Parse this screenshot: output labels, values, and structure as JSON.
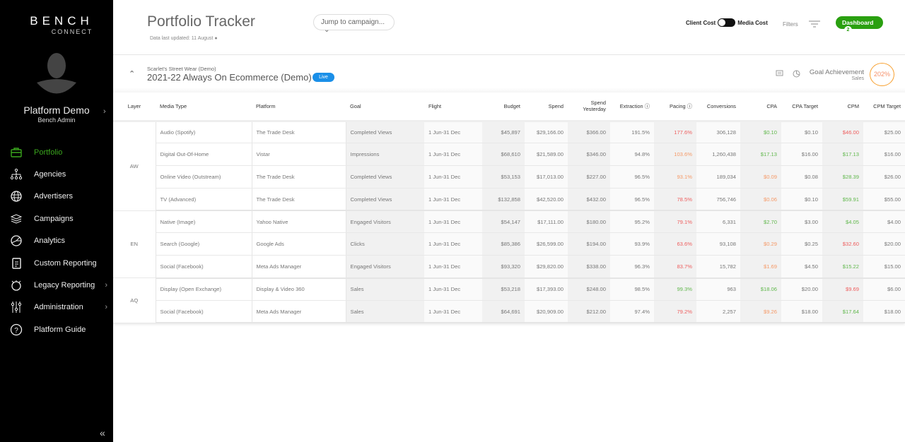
{
  "sidebar": {
    "logo_main": "BENCH",
    "logo_sub": "CONNECT",
    "user_name": "Platform Demo",
    "user_role": "Bench Admin",
    "items": [
      {
        "label": "Portfolio",
        "icon": "briefcase-icon",
        "active": true
      },
      {
        "label": "Agencies",
        "icon": "hierarchy-icon"
      },
      {
        "label": "Advertisers",
        "icon": "globe-icon"
      },
      {
        "label": "Campaigns",
        "icon": "layers-icon"
      },
      {
        "label": "Analytics",
        "icon": "pie-chart-icon"
      },
      {
        "label": "Custom Reporting",
        "icon": "document-icon"
      },
      {
        "label": "Legacy Reporting",
        "icon": "stopwatch-icon",
        "chevron": true
      },
      {
        "label": "Administration",
        "icon": "sliders-icon",
        "chevron": true
      },
      {
        "label": "Platform Guide",
        "icon": "help-icon"
      }
    ]
  },
  "header": {
    "title": "Portfolio Tracker",
    "updated": "Data last updated: 11 August",
    "jump_placeholder": "Jump to campaign...",
    "client_cost": "Client Cost",
    "media_cost": "Media Cost",
    "filters": "Filters",
    "dashboard": "Dashboard",
    "dashboard_count": "2"
  },
  "campaign": {
    "client": "Scarlet's Street Wear (Demo)",
    "name": "2021-22 Always On Ecommerce (Demo)",
    "status": "Live",
    "goal_label": "Goal Achievement",
    "goal_type": "Sales",
    "goal_value": "202%"
  },
  "colors": {
    "green": "#62b84e",
    "orange": "#f59a68",
    "red": "#ee5f5f"
  },
  "table": {
    "headers": [
      "Layer",
      "Media Type",
      "Platform",
      "Goal",
      "Flight",
      "Budget",
      "Spend",
      "Spend Yesterday",
      "Extraction ⓘ",
      "Pacing ⓘ",
      "Conversions",
      "CPA",
      "CPA Target",
      "CPM",
      "CPM Target"
    ],
    "groups": [
      {
        "layer": "AW",
        "rows": [
          [
            "Audio (Spotify)",
            "The Trade Desk",
            "Completed Views",
            "1 Jun-31 Dec",
            "$45,897",
            "$29,166.00",
            "$366.00",
            "191.5%",
            [
              "177.6%",
              "red"
            ],
            "306,128",
            [
              "$0.10",
              "green"
            ],
            "$0.10",
            [
              "$46.00",
              "red"
            ],
            "$25.00"
          ],
          [
            "Digital Out-Of-Home",
            "Vistar",
            "Impressions",
            "1 Jun-31 Dec",
            "$68,610",
            "$21,589.00",
            "$346.00",
            "94.8%",
            [
              "103.6%",
              "orange"
            ],
            "1,260,438",
            [
              "$17.13",
              "green"
            ],
            "$16.00",
            [
              "$17.13",
              "green"
            ],
            "$16.00"
          ],
          [
            "Online Video (Outstream)",
            "The Trade Desk",
            "Completed Views",
            "1 Jun-31 Dec",
            "$53,153",
            "$17,013.00",
            "$227.00",
            "96.5%",
            [
              "93.1%",
              "orange"
            ],
            "189,034",
            [
              "$0.09",
              "orange"
            ],
            "$0.08",
            [
              "$28.39",
              "green"
            ],
            "$26.00"
          ],
          [
            "TV (Advanced)",
            "The Trade Desk",
            "Completed Views",
            "1 Jun-31 Dec",
            "$132,858",
            "$42,520.00",
            "$432.00",
            "96.5%",
            [
              "78.5%",
              "red"
            ],
            "756,746",
            [
              "$0.06",
              "orange"
            ],
            "$0.10",
            [
              "$59.91",
              "green"
            ],
            "$55.00"
          ]
        ]
      },
      {
        "layer": "EN",
        "rows": [
          [
            "Native (Image)",
            "Yahoo Native",
            "Engaged Visitors",
            "1 Jun-31 Dec",
            "$54,147",
            "$17,111.00",
            "$180.00",
            "95.2%",
            [
              "79.1%",
              "red"
            ],
            "6,331",
            [
              "$2.70",
              "green"
            ],
            "$3.00",
            [
              "$4.05",
              "green"
            ],
            "$4.00"
          ],
          [
            "Search (Google)",
            "Google Ads",
            "Clicks",
            "1 Jun-31 Dec",
            "$85,386",
            "$26,599.00",
            "$194.00",
            "93.9%",
            [
              "63.6%",
              "red"
            ],
            "93,108",
            [
              "$0.29",
              "orange"
            ],
            "$0.25",
            [
              "$32.60",
              "red"
            ],
            "$20.00"
          ],
          [
            "Social (Facebook)",
            "Meta Ads Manager",
            "Engaged Visitors",
            "1 Jun-31 Dec",
            "$93,320",
            "$29,820.00",
            "$338.00",
            "96.3%",
            [
              "83.7%",
              "red"
            ],
            "15,782",
            [
              "$1.69",
              "orange"
            ],
            "$4.50",
            [
              "$15.22",
              "green"
            ],
            "$15.00"
          ]
        ]
      },
      {
        "layer": "AQ",
        "rows": [
          [
            "Display (Open Exchange)",
            "Display & Video 360",
            "Sales",
            "1 Jun-31 Dec",
            "$53,218",
            "$17,393.00",
            "$248.00",
            "98.5%",
            [
              "99.3%",
              "green"
            ],
            "963",
            [
              "$18.06",
              "green"
            ],
            "$20.00",
            [
              "$9.69",
              "red"
            ],
            "$6.00"
          ],
          [
            "Social (Facebook)",
            "Meta Ads Manager",
            "Sales",
            "1 Jun-31 Dec",
            "$64,691",
            "$20,909.00",
            "$212.00",
            "97.4%",
            [
              "79.2%",
              "red"
            ],
            "2,257",
            [
              "$9.26",
              "orange"
            ],
            "$18.00",
            [
              "$17.64",
              "green"
            ],
            "$18.00"
          ]
        ]
      }
    ]
  }
}
